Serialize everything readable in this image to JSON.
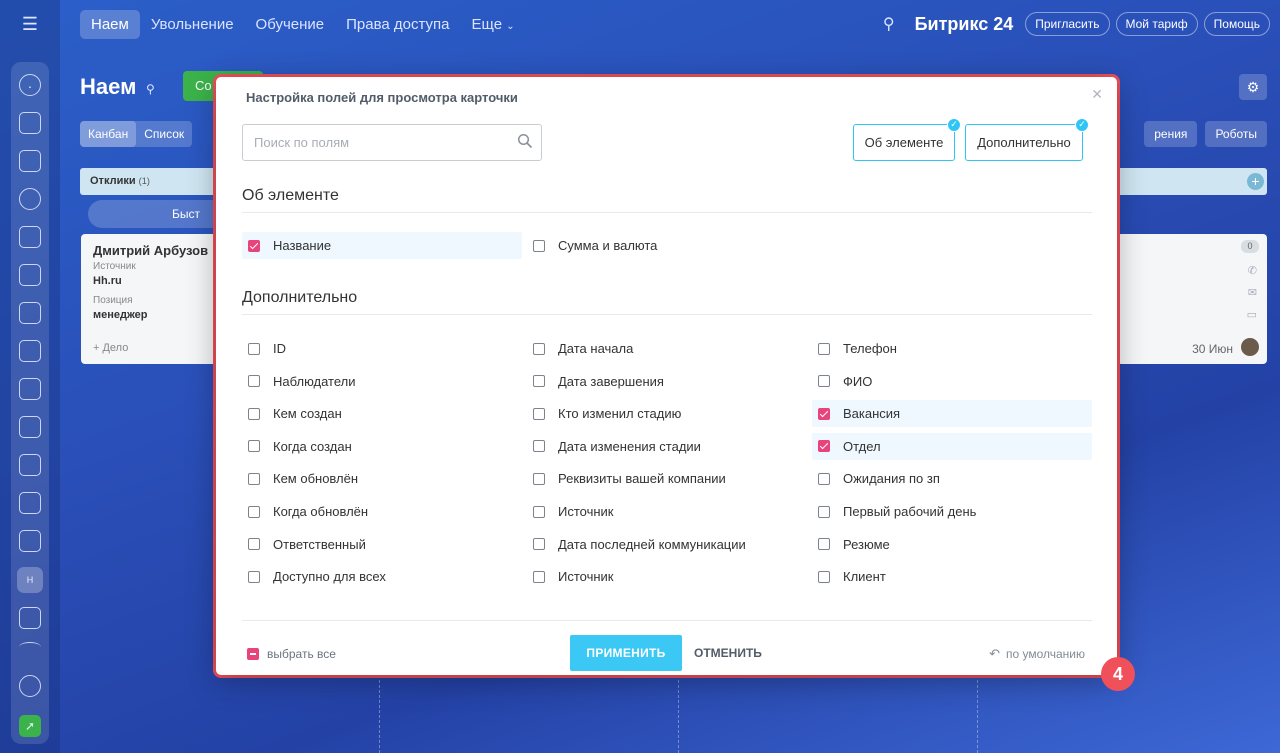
{
  "topnav": {
    "tabs": [
      "Наем",
      "Увольнение",
      "Обучение",
      "Права доступа",
      "Еще"
    ],
    "brand": "Битрикс 24",
    "pills": [
      "Пригласить",
      "Мой тариф",
      "Помощь"
    ]
  },
  "page": {
    "title": "Наем",
    "create_label": "Со",
    "view_tabs": [
      "Канбан",
      "Список"
    ],
    "tools": [
      "рения",
      "Роботы"
    ],
    "column_title": "Отклики",
    "column_count": "(1)",
    "quick_add": "Быст",
    "card": {
      "name": "Дмитрий Арбузов",
      "source_key": "Источник",
      "source_value": "Hh.ru",
      "position_key": "Позиция",
      "position_value": "менеджер",
      "deal": "+ Дело"
    },
    "card2": {
      "badge": "0",
      "date": "30 Июн"
    }
  },
  "rail": {
    "avatar_letter": "Н"
  },
  "modal": {
    "title": "Настройка полей для просмотра карточки",
    "search_placeholder": "Поиск по полям",
    "section_buttons": [
      "Об элементе",
      "Дополнительно"
    ],
    "section1": {
      "title": "Об элементе",
      "fields": [
        {
          "label": "Название",
          "checked": true
        },
        {
          "label": "Сумма и валюта",
          "checked": false
        }
      ]
    },
    "section2": {
      "title": "Дополнительно",
      "columns": [
        [
          {
            "label": "ID",
            "checked": false
          },
          {
            "label": "Наблюдатели",
            "checked": false
          },
          {
            "label": "Кем создан",
            "checked": false
          },
          {
            "label": "Когда создан",
            "checked": false
          },
          {
            "label": "Кем обновлён",
            "checked": false
          },
          {
            "label": "Когда обновлён",
            "checked": false
          },
          {
            "label": "Ответственный",
            "checked": false
          },
          {
            "label": "Доступно для всех",
            "checked": false
          }
        ],
        [
          {
            "label": "Дата начала",
            "checked": false
          },
          {
            "label": "Дата завершения",
            "checked": false
          },
          {
            "label": "Кто изменил стадию",
            "checked": false
          },
          {
            "label": "Дата изменения стадии",
            "checked": false
          },
          {
            "label": "Реквизиты вашей компании",
            "checked": false
          },
          {
            "label": "Источник",
            "checked": false
          },
          {
            "label": "Дата последней коммуникации",
            "checked": false
          },
          {
            "label": "Источник",
            "checked": false
          }
        ],
        [
          {
            "label": "Телефон",
            "checked": false
          },
          {
            "label": "ФИО",
            "checked": false
          },
          {
            "label": "Вакансия",
            "checked": true
          },
          {
            "label": "Отдел",
            "checked": true
          },
          {
            "label": "Ожидания по зп",
            "checked": false
          },
          {
            "label": "Первый рабочий день",
            "checked": false
          },
          {
            "label": "Резюме",
            "checked": false
          },
          {
            "label": "Клиент",
            "checked": false
          }
        ]
      ]
    },
    "footer": {
      "select_all": "выбрать все",
      "apply": "ПРИМЕНИТЬ",
      "cancel": "ОТМЕНИТЬ",
      "default": "по умолчанию"
    }
  },
  "step_badge": "4",
  "colors": {
    "accent": "#2fc6f6",
    "apply": "#3bc8f5",
    "checkbox_on": "#e8437a",
    "highlight_border": "#f0505a"
  }
}
